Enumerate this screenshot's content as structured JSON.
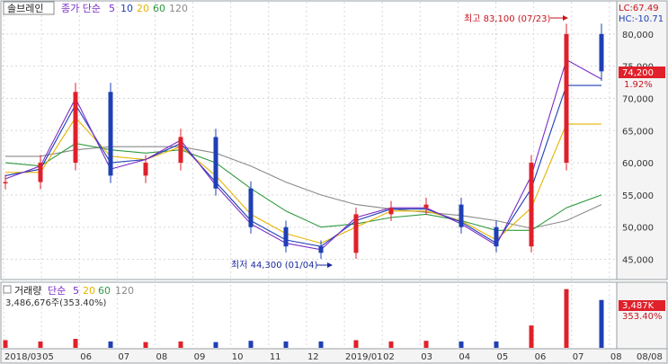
{
  "stock": {
    "name": "솔브레인",
    "legend_prefix": "종가 단순",
    "ma_periods": [
      "5",
      "10",
      "20",
      "60",
      "120"
    ]
  },
  "top_right": {
    "lc": "LC:67.49",
    "hc": "HC:-10.71"
  },
  "price_box": {
    "value": "74,200",
    "change": "1.92%"
  },
  "annotations": {
    "high": "최고 83,100 (07/23)",
    "low": "최저 44,300 (01/04)"
  },
  "volume": {
    "title": "거래량",
    "legend_prefix": "단순",
    "ma_periods": [
      "5",
      "20",
      "60",
      "120"
    ],
    "value_text": "3,486,676주(353.40%)",
    "box_value": "3,487K",
    "box_pct": "353.40%"
  },
  "colors": {
    "up": "#e0202a",
    "down": "#1f3fb5",
    "ma5": "#7a2cc8",
    "ma10": "#1f3fb5",
    "ma20": "#e6b400",
    "ma60": "#2e9a3e",
    "ma120": "#8a8a8a",
    "label_bg": "#e0202a",
    "grid": "#d8d8d8"
  },
  "chart_data": {
    "type": "line",
    "title": "",
    "xlabel": "",
    "ylabel": "",
    "ylim": [
      42000,
      85000
    ],
    "y_ticks": [
      45000,
      50000,
      55000,
      60000,
      65000,
      70000,
      75000,
      80000
    ],
    "y_tick_labels": [
      "45,000",
      "50,000",
      "55,000",
      "60,000",
      "65,000",
      "70,000",
      "75,000",
      "80,000"
    ],
    "x_tick_labels": [
      "2018/03",
      "05",
      "06",
      "07",
      "08",
      "09",
      "10",
      "11",
      "12",
      "2019/01",
      "02",
      "03",
      "04",
      "05",
      "06",
      "07",
      "08",
      "08/08"
    ],
    "x": [
      "2018/03",
      "05",
      "06",
      "07",
      "08",
      "09",
      "10",
      "11",
      "12",
      "2019/01",
      "02",
      "03",
      "04",
      "05",
      "06",
      "07",
      "07/23",
      "08"
    ],
    "series": [
      {
        "name": "종가",
        "values": [
          57000,
          60000,
          71000,
          58000,
          60000,
          64000,
          56000,
          50000,
          47000,
          46000,
          52000,
          53000,
          53500,
          50000,
          47000,
          60000,
          80000,
          74200
        ]
      },
      {
        "name": "5",
        "values": [
          57500,
          59500,
          70000,
          59000,
          60500,
          63500,
          56500,
          50500,
          47500,
          46500,
          51500,
          53000,
          53000,
          50500,
          47200,
          58000,
          76000,
          73000
        ]
      },
      {
        "name": "10",
        "values": [
          58000,
          59000,
          69000,
          60000,
          60500,
          63000,
          57000,
          51000,
          48000,
          47000,
          51000,
          52800,
          52800,
          50800,
          47500,
          56000,
          72000,
          72000
        ]
      },
      {
        "name": "20",
        "values": [
          58500,
          58500,
          67000,
          61000,
          60500,
          62500,
          58000,
          52000,
          49000,
          47500,
          50000,
          52500,
          52500,
          51000,
          48000,
          53000,
          66000,
          66000
        ]
      },
      {
        "name": "60",
        "values": [
          60000,
          59500,
          63000,
          62000,
          61500,
          62000,
          60000,
          56000,
          52500,
          50000,
          50500,
          51500,
          52000,
          51000,
          49500,
          49500,
          53000,
          55000
        ]
      },
      {
        "name": "120",
        "values": [
          61000,
          61000,
          62000,
          62500,
          62500,
          62500,
          61500,
          59500,
          57000,
          55000,
          53500,
          52800,
          52300,
          51800,
          51000,
          49800,
          51000,
          53500
        ]
      }
    ],
    "volume_values": [
      0.12,
      0.1,
      0.14,
      0.1,
      0.09,
      0.1,
      0.09,
      0.11,
      0.1,
      0.1,
      0.12,
      0.1,
      0.11,
      0.1,
      0.1,
      0.35,
      0.92,
      0.75
    ]
  }
}
